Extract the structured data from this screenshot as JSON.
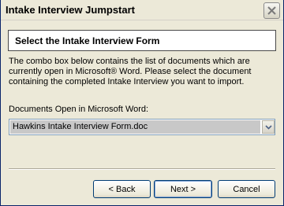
{
  "window": {
    "title": "Intake Interview Jumpstart",
    "close_icon": "close-icon"
  },
  "header": {
    "title": "Select the Intake Interview Form"
  },
  "body": {
    "description": "The combo box below contains the list of documents which are\ncurrently open in Microsoft® Word.  Please select the document\ncontaining the completed Intake Interview you want to import.",
    "docs_label": "Documents Open in Microsoft Word:"
  },
  "combo": {
    "selected_value": "Hawkins Intake Interview Form.doc",
    "arrow_icon": "chevron-down-icon"
  },
  "buttons": {
    "back_label": "< Back",
    "next_label": "Next >",
    "cancel_label": "Cancel"
  },
  "colors": {
    "dialog_background": "#ece9d8",
    "selection_highlight": "#c8c8c8",
    "close_icon_color": "#7a7a7a",
    "default_button_focus": "#7fa3d7"
  }
}
